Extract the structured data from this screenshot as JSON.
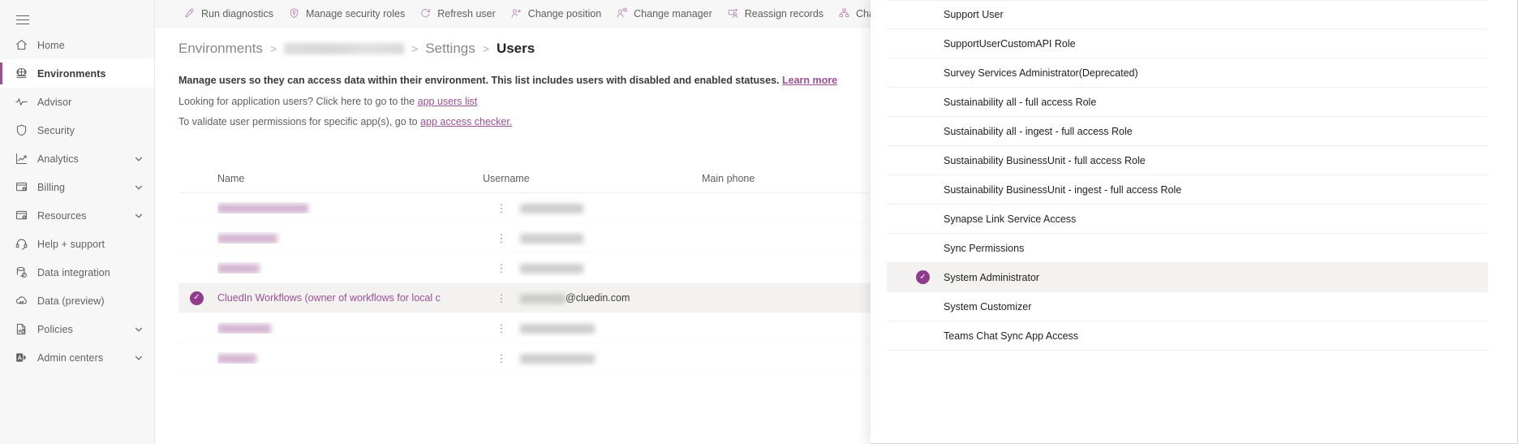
{
  "sidebar": {
    "menu_icon": "hamburger-icon",
    "items": [
      {
        "label": "Home",
        "icon": "home-icon",
        "active": false,
        "chevron": false
      },
      {
        "label": "Environments",
        "icon": "environments-icon",
        "active": true,
        "chevron": false
      },
      {
        "label": "Advisor",
        "icon": "advisor-icon",
        "active": false,
        "chevron": false
      },
      {
        "label": "Security",
        "icon": "shield-icon",
        "active": false,
        "chevron": false
      },
      {
        "label": "Analytics",
        "icon": "analytics-icon",
        "active": false,
        "chevron": true
      },
      {
        "label": "Billing",
        "icon": "billing-icon",
        "active": false,
        "chevron": true
      },
      {
        "label": "Resources",
        "icon": "resources-icon",
        "active": false,
        "chevron": true
      },
      {
        "label": "Help + support",
        "icon": "headset-icon",
        "active": false,
        "chevron": false
      },
      {
        "label": "Data integration",
        "icon": "data-integration-icon",
        "active": false,
        "chevron": false
      },
      {
        "label": "Data (preview)",
        "icon": "data-cloud-icon",
        "active": false,
        "chevron": false
      },
      {
        "label": "Policies",
        "icon": "policies-icon",
        "active": false,
        "chevron": true
      },
      {
        "label": "Admin centers",
        "icon": "admin-centers-icon",
        "active": false,
        "chevron": true
      }
    ]
  },
  "commandbar": {
    "items": [
      {
        "label": "Run diagnostics",
        "icon": "diagnostics-icon"
      },
      {
        "label": "Manage security roles",
        "icon": "security-roles-icon"
      },
      {
        "label": "Refresh user",
        "icon": "refresh-icon"
      },
      {
        "label": "Change position",
        "icon": "change-position-icon"
      },
      {
        "label": "Change manager",
        "icon": "change-manager-icon"
      },
      {
        "label": "Reassign records",
        "icon": "reassign-records-icon"
      },
      {
        "label": "Change business unit",
        "icon": "business-unit-icon"
      }
    ]
  },
  "breadcrumb": {
    "environments": "Environments",
    "environment_name": "",
    "settings": "Settings",
    "current": "Users",
    "separator": ">"
  },
  "info": {
    "headline": "Manage users so they can access data within their environment. This list includes users with disabled and enabled statuses.",
    "headline_link": "Learn more",
    "line2_prefix": "Looking for application users? Click here to go to the ",
    "line2_link": "app users list",
    "line3_prefix": "To validate user permissions for specific app(s), go to ",
    "line3_link": "app access checker."
  },
  "table": {
    "columns": [
      "Name",
      "Username",
      "Main phone"
    ],
    "rows": [
      {
        "name": "",
        "username": "",
        "phone": "",
        "selected": false,
        "redacted": true,
        "name_w": 112,
        "mail_w": 78
      },
      {
        "name": "",
        "username": "",
        "phone": "",
        "selected": false,
        "redacted": true,
        "name_w": 74,
        "mail_w": 78
      },
      {
        "name": "",
        "username": "",
        "phone": "",
        "selected": false,
        "redacted": true,
        "name_w": 52,
        "mail_w": 78
      },
      {
        "name": "CluedIn Workflows (owner of workflows for local c",
        "username": "@cluedin.com",
        "phone": "",
        "selected": true,
        "redacted": false,
        "name_w": 0,
        "mail_w": 56
      },
      {
        "name": "",
        "username": "",
        "phone": "",
        "selected": false,
        "redacted": true,
        "name_w": 66,
        "mail_w": 92
      },
      {
        "name": "",
        "username": "",
        "phone": "",
        "selected": false,
        "redacted": true,
        "name_w": 48,
        "mail_w": 92
      }
    ],
    "row_menu_icon": "more-vertical-icon",
    "selected_check_icon": "check-circle-icon"
  },
  "panel": {
    "check_icon": "check-circle-icon",
    "items": [
      {
        "label": "Support User",
        "selected": false
      },
      {
        "label": "SupportUserCustomAPI Role",
        "selected": false
      },
      {
        "label": "Survey Services Administrator(Deprecated)",
        "selected": false
      },
      {
        "label": "Sustainability all - full access Role",
        "selected": false
      },
      {
        "label": "Sustainability all - ingest - full access Role",
        "selected": false
      },
      {
        "label": "Sustainability BusinessUnit - full access Role",
        "selected": false
      },
      {
        "label": "Sustainability BusinessUnit - ingest - full access Role",
        "selected": false
      },
      {
        "label": "Synapse Link Service Access",
        "selected": false
      },
      {
        "label": "Sync Permissions",
        "selected": false
      },
      {
        "label": "System Administrator",
        "selected": true
      },
      {
        "label": "System Customizer",
        "selected": false
      },
      {
        "label": "Teams Chat Sync App Access",
        "selected": false
      }
    ]
  },
  "colors": {
    "accent": "#9b4f96",
    "accent_deep": "#8f3c8c",
    "sidebar_bg": "#f7f7f7",
    "selected_row": "#f3f2f1",
    "text": "#3b3a39",
    "muted": "#605e5c"
  }
}
